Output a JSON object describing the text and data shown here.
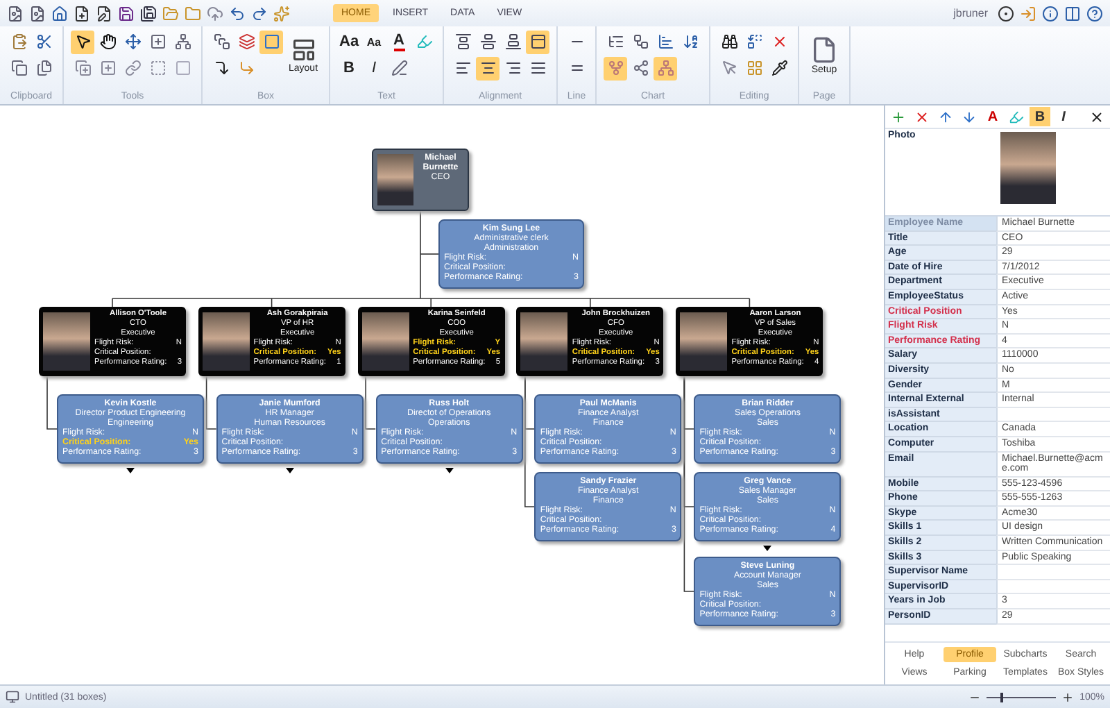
{
  "ribbon": {
    "tabs": [
      {
        "label": "HOME",
        "selected": true
      },
      {
        "label": "INSERT",
        "selected": false
      },
      {
        "label": "DATA",
        "selected": false
      },
      {
        "label": "VIEW",
        "selected": false
      }
    ],
    "user": "jbruner",
    "groups": [
      {
        "label": "Clipboard",
        "buttons": [
          {
            "active": false
          },
          {
            "active": false
          },
          {
            "active": false
          },
          {
            "active": false
          }
        ]
      },
      {
        "label": "Tools",
        "buttons": [
          {
            "active": true
          },
          {
            "active": false
          },
          {
            "active": false
          },
          {
            "active": false
          },
          {
            "active": false
          },
          {
            "active": false
          },
          {
            "active": false
          },
          {
            "active": false
          },
          {
            "active": false
          },
          {
            "active": false
          }
        ]
      },
      {
        "label": "Box",
        "buttons": [
          {
            "active": false
          },
          {
            "active": false
          },
          {
            "active": true
          },
          {
            "label": "Layout",
            "active": false
          },
          {
            "active": false
          },
          {
            "active": false
          }
        ]
      },
      {
        "label": "Text",
        "buttons": [
          {
            "glyph": "Aa",
            "active": false
          },
          {
            "glyph": "Aa",
            "active": false
          },
          {
            "glyph": "A",
            "active": false
          },
          {
            "active": false
          },
          {
            "glyph": "B",
            "active": false
          },
          {
            "glyph": "I",
            "active": false
          },
          {
            "active": false
          }
        ]
      },
      {
        "label": "Alignment",
        "buttons": [
          {
            "active": false
          },
          {
            "active": false
          },
          {
            "active": false
          },
          {
            "active": true
          },
          {
            "active": false
          },
          {
            "active": true
          },
          {
            "active": false
          },
          {
            "active": false
          }
        ]
      },
      {
        "label": "Line",
        "buttons": [
          {
            "active": false
          },
          {
            "active": false
          }
        ]
      },
      {
        "label": "Chart",
        "buttons": [
          {
            "active": false
          },
          {
            "active": false
          },
          {
            "active": false
          },
          {
            "active": false
          },
          {
            "active": true
          },
          {
            "active": false
          },
          {
            "active": true
          }
        ]
      },
      {
        "label": "Editing",
        "buttons": [
          {
            "active": false
          },
          {
            "active": false
          },
          {
            "active": false
          },
          {
            "active": false
          },
          {
            "active": false
          },
          {
            "active": false
          }
        ]
      },
      {
        "label": "Page",
        "buttons": [
          {
            "label": "Setup",
            "active": false
          }
        ]
      }
    ]
  },
  "chart": {
    "root": {
      "kind": "ceo",
      "name": "Michael Burnette",
      "title": "CEO",
      "collapsed": false,
      "assistant": {
        "kind": "standard",
        "name": "Kim Sung Lee",
        "title": "Administrative clerk",
        "department": "Administration",
        "collapsed": false,
        "fields": [
          {
            "label": "Flight Risk:",
            "value": "N",
            "alert": false
          },
          {
            "label": "Critical Position:",
            "alert": false
          },
          {
            "label": "Performance Rating:",
            "value": "3",
            "alert": false
          }
        ]
      },
      "children": [
        {
          "kind": "photo",
          "name": "Allison O'Toole",
          "title": "CTO",
          "department": "Executive",
          "collapsed": false,
          "fields": [
            {
              "label": "Flight Risk:",
              "value": "N",
              "alert": false
            },
            {
              "label": "Critical Position:",
              "alert": false
            },
            {
              "label": "Performance Rating:",
              "value": "3",
              "alert": false
            }
          ],
          "children": [
            {
              "kind": "standard",
              "name": "Kevin Kostle",
              "title": "Director Product Engineering",
              "department": "Engineering",
              "collapsed": true,
              "fields": [
                {
                  "label": "Flight Risk:",
                  "value": "N",
                  "alert": false
                },
                {
                  "label": "Critical Position:",
                  "value": "Yes",
                  "alert": true
                },
                {
                  "label": "Performance Rating:",
                  "value": "3",
                  "alert": false
                }
              ]
            }
          ]
        },
        {
          "kind": "photo",
          "name": "Ash Gorakpiraia",
          "title": "VP of HR",
          "department": "Executive",
          "collapsed": false,
          "fields": [
            {
              "label": "Flight Risk:",
              "value": "N",
              "alert": false
            },
            {
              "label": "Critical Position:",
              "value": "Yes",
              "alert": true
            },
            {
              "label": "Performance Rating:",
              "value": "1",
              "alert": false
            }
          ],
          "children": [
            {
              "kind": "standard",
              "name": "Janie Mumford",
              "title": "HR Manager",
              "department": "Human Resources",
              "collapsed": true,
              "fields": [
                {
                  "label": "Flight Risk:",
                  "value": "N",
                  "alert": false
                },
                {
                  "label": "Critical Position:",
                  "alert": false
                },
                {
                  "label": "Performance Rating:",
                  "value": "3",
                  "alert": false
                }
              ]
            }
          ]
        },
        {
          "kind": "photo",
          "name": "Karina Seinfeld",
          "title": "COO",
          "department": "Executive",
          "collapsed": false,
          "fields": [
            {
              "label": "Flight Risk:",
              "value": "Y",
              "alert": true
            },
            {
              "label": "Critical Position:",
              "value": "Yes",
              "alert": true
            },
            {
              "label": "Performance Rating:",
              "value": "5",
              "alert": false
            }
          ],
          "children": [
            {
              "kind": "standard",
              "name": "Russ Holt",
              "title": "Directot of Operations",
              "department": "Operations",
              "collapsed": true,
              "fields": [
                {
                  "label": "Flight Risk:",
                  "value": "N",
                  "alert": false
                },
                {
                  "label": "Critical Position:",
                  "alert": false
                },
                {
                  "label": "Performance Rating:",
                  "value": "3",
                  "alert": false
                }
              ]
            }
          ]
        },
        {
          "kind": "photo",
          "name": "John Brockhuizen",
          "title": "CFO",
          "department": "Executive",
          "collapsed": false,
          "fields": [
            {
              "label": "Flight Risk:",
              "value": "N",
              "alert": false
            },
            {
              "label": "Critical Position:",
              "value": "Yes",
              "alert": true
            },
            {
              "label": "Performance Rating:",
              "value": "3",
              "alert": false
            }
          ],
          "children": [
            {
              "kind": "standard",
              "name": "Paul McManis",
              "title": "Finance Analyst",
              "department": "Finance",
              "collapsed": false,
              "fields": [
                {
                  "label": "Flight Risk:",
                  "value": "N",
                  "alert": false
                },
                {
                  "label": "Critical Position:",
                  "alert": false
                },
                {
                  "label": "Performance Rating:",
                  "value": "3",
                  "alert": false
                }
              ]
            },
            {
              "kind": "standard",
              "name": "Sandy Frazier",
              "title": "Finance Analyst",
              "department": "Finance",
              "collapsed": false,
              "fields": [
                {
                  "label": "Flight Risk:",
                  "value": "N",
                  "alert": false
                },
                {
                  "label": "Critical Position:",
                  "alert": false
                },
                {
                  "label": "Performance Rating:",
                  "value": "3",
                  "alert": false
                }
              ]
            }
          ]
        },
        {
          "kind": "photo",
          "name": "Aaron Larson",
          "title": "VP of Sales",
          "department": "Executive",
          "collapsed": false,
          "fields": [
            {
              "label": "Flight Risk:",
              "value": "N",
              "alert": false
            },
            {
              "label": "Critical Position:",
              "value": "Yes",
              "alert": true
            },
            {
              "label": "Performance Rating:",
              "value": "4",
              "alert": false
            }
          ],
          "children": [
            {
              "kind": "standard",
              "name": "Brian Ridder",
              "title": "Sales Operations",
              "department": "Sales",
              "collapsed": false,
              "fields": [
                {
                  "label": "Flight Risk:",
                  "value": "N",
                  "alert": false
                },
                {
                  "label": "Critical Position:",
                  "alert": false
                },
                {
                  "label": "Performance Rating:",
                  "value": "3",
                  "alert": false
                }
              ]
            },
            {
              "kind": "standard",
              "name": "Greg Vance",
              "title": "Sales Manager",
              "department": "Sales",
              "collapsed": true,
              "fields": [
                {
                  "label": "Flight Risk:",
                  "value": "N",
                  "alert": false
                },
                {
                  "label": "Critical Position:",
                  "alert": false
                },
                {
                  "label": "Performance Rating:",
                  "value": "4",
                  "alert": false
                }
              ]
            },
            {
              "kind": "standard",
              "name": "Steve Luning",
              "title": "Account Manager",
              "department": "Sales",
              "collapsed": false,
              "fields": [
                {
                  "label": "Flight Risk:",
                  "value": "N",
                  "alert": false
                },
                {
                  "label": "Critical Position:",
                  "alert": false
                },
                {
                  "label": "Performance Rating:",
                  "value": "3",
                  "alert": false
                }
              ]
            }
          ]
        }
      ]
    }
  },
  "panel": {
    "toolbar": [
      {
        "active": false
      },
      {
        "active": false
      },
      {
        "active": false
      },
      {
        "active": false
      },
      {
        "glyph": "A",
        "active": false
      },
      {
        "active": false
      },
      {
        "glyph": "B",
        "active": true
      },
      {
        "glyph": "I",
        "active": false
      },
      {
        "active": false
      }
    ],
    "photo_label": "Photo",
    "rows": [
      {
        "label": "Employee Name",
        "value": "Michael Burnette",
        "kind": "key"
      },
      {
        "label": "Title",
        "value": "CEO",
        "kind": "field"
      },
      {
        "label": "Age",
        "value": "29",
        "kind": "field"
      },
      {
        "label": "Date of Hire",
        "value": "7/1/2012",
        "kind": "field"
      },
      {
        "label": "Department",
        "value": "Executive",
        "kind": "field"
      },
      {
        "label": "EmployeeStatus",
        "value": "Active",
        "kind": "field"
      },
      {
        "label": "Critical Position",
        "value": "Yes",
        "kind": "alert"
      },
      {
        "label": "Flight Risk",
        "value": "N",
        "kind": "alert"
      },
      {
        "label": "Performance Rating",
        "value": "4",
        "kind": "alert"
      },
      {
        "label": "Salary",
        "value": "1110000",
        "kind": "field"
      },
      {
        "label": "Diversity",
        "value": "No",
        "kind": "field"
      },
      {
        "label": "Gender",
        "value": "M",
        "kind": "field"
      },
      {
        "label": "Internal External",
        "value": "Internal",
        "kind": "field"
      },
      {
        "label": "isAssistant",
        "kind": "field"
      },
      {
        "label": "Location",
        "value": "Canada",
        "kind": "field"
      },
      {
        "label": "Computer",
        "value": "Toshiba",
        "kind": "field"
      },
      {
        "label": "Email",
        "value": "Michael.Burnette@acme.com",
        "kind": "field"
      },
      {
        "label": "Mobile",
        "value": "555-123-4596",
        "kind": "field"
      },
      {
        "label": "Phone",
        "value": "555-555-1263",
        "kind": "field"
      },
      {
        "label": "Skype",
        "value": "Acme30",
        "kind": "field"
      },
      {
        "label": "Skills 1",
        "value": "UI design",
        "kind": "field"
      },
      {
        "label": "Skills 2",
        "value": "Written Communication",
        "kind": "field"
      },
      {
        "label": "Skills 3",
        "value": "Public Speaking",
        "kind": "field"
      },
      {
        "label": "Supervisor Name",
        "kind": "field"
      },
      {
        "label": "SupervisorID",
        "kind": "field"
      },
      {
        "label": "Years in Job",
        "value": "3",
        "kind": "field"
      },
      {
        "label": "PersonID",
        "value": "29",
        "kind": "field"
      }
    ],
    "tabs": [
      {
        "label": "Help",
        "selected": false
      },
      {
        "label": "Profile",
        "selected": true
      },
      {
        "label": "Subcharts",
        "selected": false
      },
      {
        "label": "Search",
        "selected": false
      },
      {
        "label": "Views",
        "selected": false
      },
      {
        "label": "Parking",
        "selected": false
      },
      {
        "label": "Templates",
        "selected": false
      },
      {
        "label": "Box Styles",
        "selected": false
      }
    ]
  },
  "status_bar": {
    "document": "Untitled (31 boxes)",
    "zoom": {
      "level": 0.2,
      "reading": "100%"
    }
  }
}
